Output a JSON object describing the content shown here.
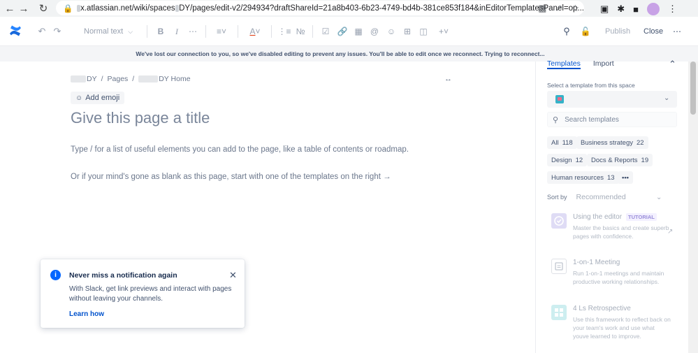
{
  "browser": {
    "url_host": "x.atlassian.net/wiki/spaces",
    "url_path": "DY/pages/edit-v2/294934?draftShareId=21a8b403-6b23-4749-bd4b-381ce853f184&inEditorTemplatesPanel=op..."
  },
  "toolbar": {
    "text_style": "Normal text",
    "publish_label": "Publish",
    "close_label": "Close"
  },
  "banner": {
    "message": "We've lost our connection to you, so we've disabled editing to prevent any issues. You'll be able to edit once we reconnect. Trying to reconnect..."
  },
  "editor": {
    "breadcrumb": {
      "space": "DY",
      "pages": "Pages",
      "home": "DY Home"
    },
    "add_emoji_label": "Add emoji",
    "title_placeholder": "Give this page a title",
    "hint_line1": "Type / for a list of useful elements you can add to the page, like a table of contents or roadmap.",
    "hint_line2": "Or if your mind's gone as blank as this page, start with one of the templates on the right →"
  },
  "notification": {
    "title": "Never miss a notification again",
    "body": "With Slack, get link previews and interact with pages without leaving your channels.",
    "link": "Learn how"
  },
  "panel": {
    "tabs": [
      "Templates",
      "Import"
    ],
    "select_label": "Select a template from this space",
    "search_placeholder": "Search templates",
    "categories": [
      {
        "label": "All",
        "count": "118"
      },
      {
        "label": "Business strategy",
        "count": "22"
      },
      {
        "label": "Design",
        "count": "12"
      },
      {
        "label": "Docs & Reports",
        "count": "19"
      },
      {
        "label": "Human resources",
        "count": "13"
      }
    ],
    "more_label": "•••",
    "sort_label": "Sort by",
    "sort_value": "Recommended",
    "templates": [
      {
        "title": "Using the editor",
        "badge": "TUTORIAL",
        "desc": "Master the basics and create superb pages with confidence.",
        "color": "#dfdcf5"
      },
      {
        "title": "1-on-1 Meeting",
        "badge": "",
        "desc": "Run 1-on-1 meetings and maintain productive working relationships.",
        "color": "#d9e2f3"
      },
      {
        "title": "4 Ls Retrospective",
        "badge": "",
        "desc": "Use this framework to reflect back on your team's work and use what youve learned to improve.",
        "color": "#cdeef0"
      }
    ]
  },
  "colors": {
    "accent": "#0052cc",
    "info": "#0065ff",
    "logo": "#1868db"
  }
}
